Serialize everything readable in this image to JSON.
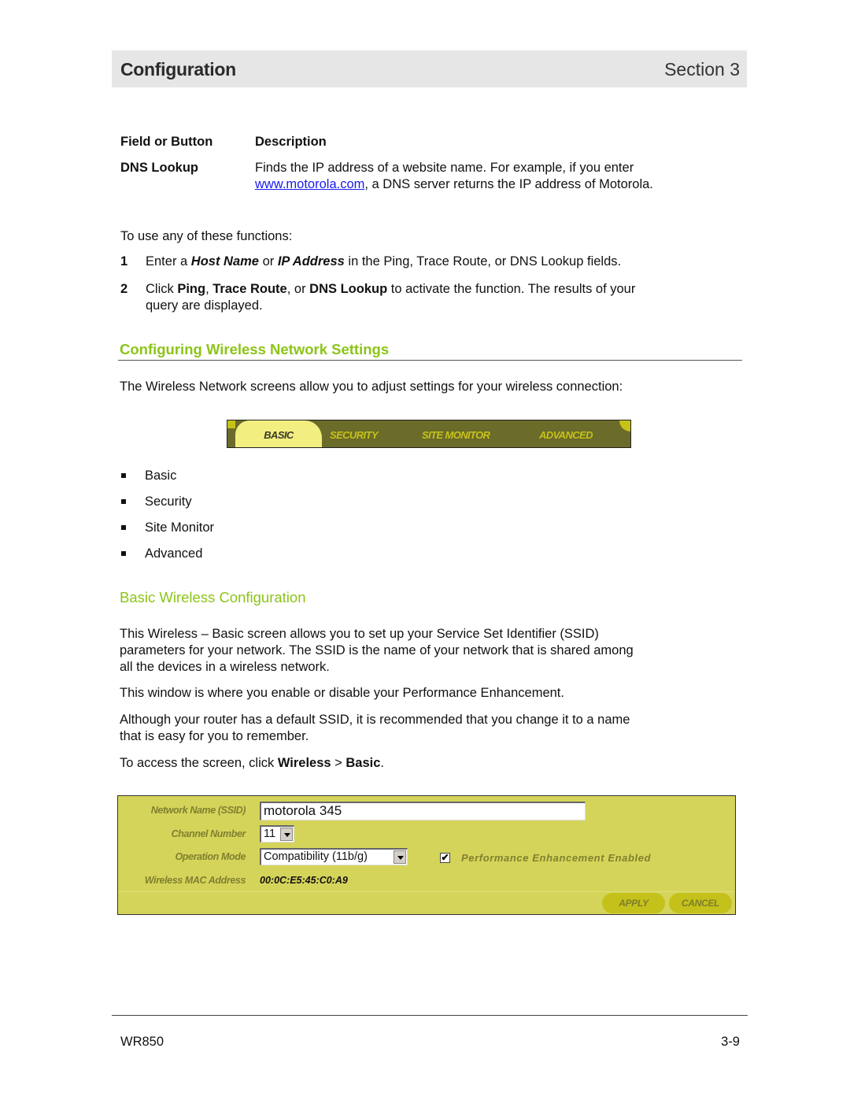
{
  "header": {
    "title": "Configuration",
    "section": "Section 3"
  },
  "field_table": {
    "col_headers": [
      "Field or Button",
      "Description"
    ],
    "rows": [
      {
        "field": "DNS Lookup",
        "desc_line1": "Finds the IP address of a website name. For example, if you enter",
        "desc_link": "www.motorola.com",
        "desc_line2_rest": ", a DNS server returns the IP address of Motorola."
      }
    ]
  },
  "usage": {
    "intro": "To use any of these functions:",
    "steps": [
      {
        "num": "1",
        "parts": [
          "Enter a ",
          "Host Name",
          " or ",
          "IP Address",
          " in the Ping, Trace Route, or DNS Lookup fields."
        ]
      },
      {
        "num": "2",
        "parts": [
          "Click ",
          "Ping",
          ", ",
          "Trace Route",
          ", or ",
          "DNS Lookup",
          " to activate the function. The results of your",
          "query are displayed."
        ]
      }
    ]
  },
  "wireless_section": {
    "heading": "Configuring Wireless Network Settings",
    "intro": "The Wireless Network screens allow you to adjust settings for your wireless connection:",
    "tabs": [
      {
        "label": "BASIC",
        "active": true
      },
      {
        "label": "SECURITY",
        "active": false
      },
      {
        "label": "SITE MONITOR",
        "active": false
      },
      {
        "label": "ADVANCED",
        "active": false
      }
    ],
    "bullets": [
      "Basic",
      "Security",
      "Site Monitor",
      "Advanced"
    ]
  },
  "basic_section": {
    "heading": "Basic Wireless Configuration",
    "para1": [
      "This Wireless – Basic screen allows you to set up your Service Set Identifier (SSID)",
      "parameters for your network. The SSID is the name of your network that is shared among",
      "all the devices in a wireless network."
    ],
    "para2": "This window is where you enable or disable your Performance Enhancement.",
    "para3": [
      "Although your router has a default SSID, it is recommended that you change it to a name",
      "that is easy for you to remember."
    ],
    "para4": {
      "pre": "To access the screen, click ",
      "b1": "Wireless",
      "mid": " > ",
      "b2": "Basic",
      "post": "."
    }
  },
  "panel": {
    "labels": {
      "ssid": "Network Name (SSID)",
      "channel": "Channel Number",
      "mode": "Operation Mode",
      "mac": "Wireless MAC Address"
    },
    "ssid_value": "motorola 345",
    "channel_value": "11",
    "mode_value": "Compatibility (11b/g)",
    "mac_value": "00:0C:E5:45:C0:A9",
    "perf_label": "Performance Enhancement Enabled",
    "perf_checked": true,
    "perf_check_glyph": "✔",
    "apply_label": "APPLY",
    "cancel_label": "CANCEL"
  },
  "colors": {
    "heading_green": "#8cc417",
    "panel_bg": "#d5d45a",
    "tab_bar": "#6b6b2a",
    "tab_active": "#f2ef80"
  },
  "footer": {
    "model": "WR850",
    "page": "3-9"
  }
}
